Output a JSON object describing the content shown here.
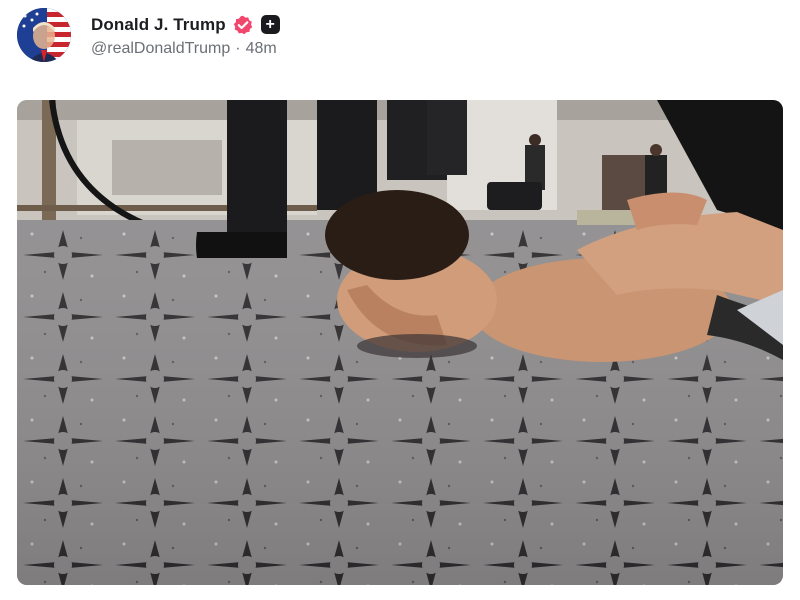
{
  "post": {
    "author": {
      "display_name": "Donald J. Trump",
      "handle": "@realDonaldTrump",
      "verified": true,
      "verified_badge_color": "#f2466c",
      "avatar_icon": "flag-portrait-avatar",
      "follow_icon": "plus-icon",
      "follow_glyph": "+"
    },
    "separator": "·",
    "timestamp": "48m",
    "media": {
      "kind": "photo",
      "icon": "photo-image"
    }
  },
  "colors": {
    "text_primary": "#1c1e21",
    "text_secondary": "#6b6f76",
    "verified": "#f2466c",
    "follow_button": "#1b1b1f"
  }
}
